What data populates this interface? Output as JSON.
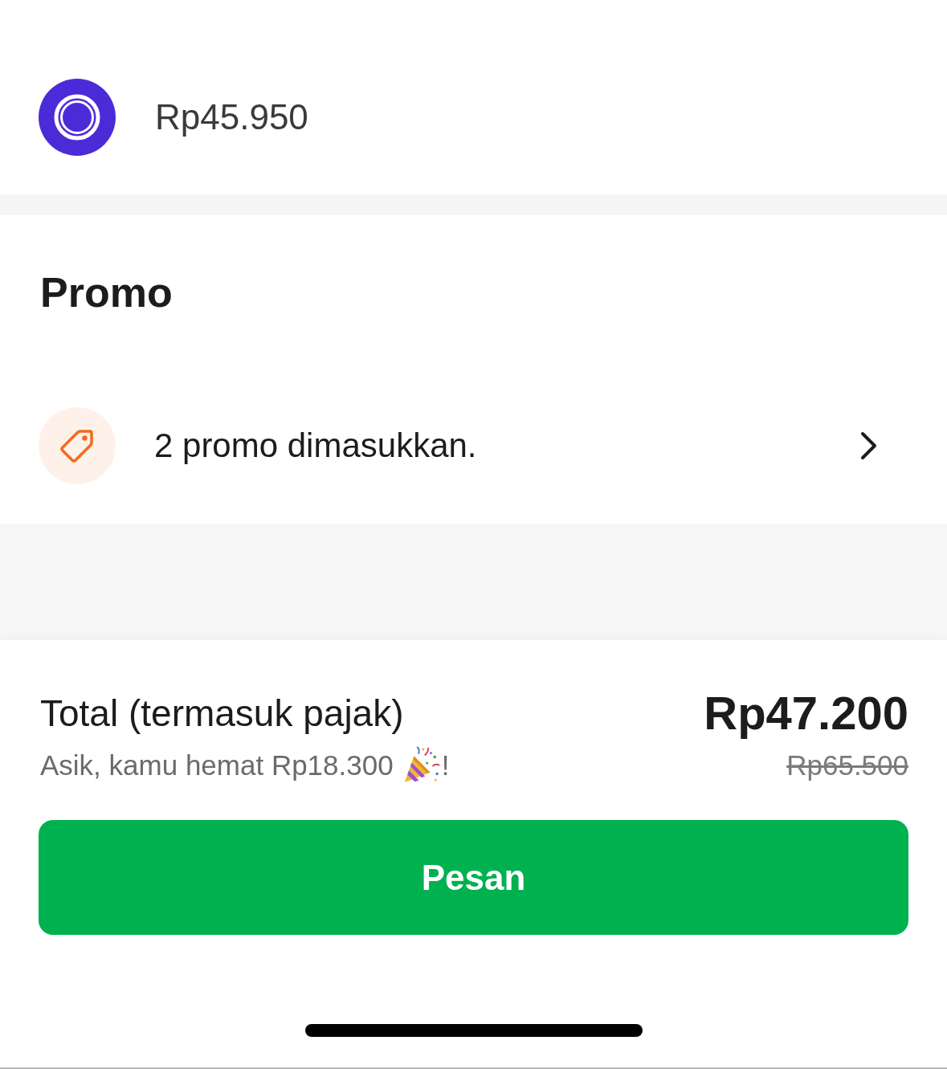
{
  "payment": {
    "amount": "Rp45.950"
  },
  "promo": {
    "title": "Promo",
    "applied_label": "2 promo dimasukkan."
  },
  "summary": {
    "total_label": "Total (termasuk pajak)",
    "total": "Rp47.200",
    "savings_text": "Asik, kamu hemat Rp18.300",
    "savings_end": "!",
    "original_price": "Rp65.500"
  },
  "order_button": {
    "label": "Pesan"
  }
}
